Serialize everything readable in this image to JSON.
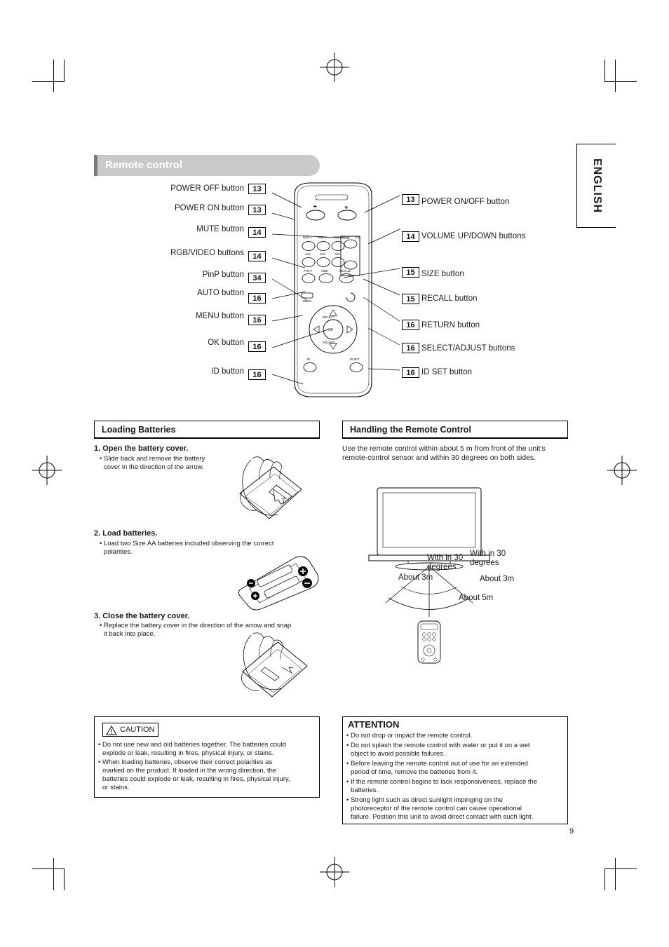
{
  "language_tab": "ENGLISH",
  "section_title": "Remote control",
  "page_number": "9",
  "remote_callouts_left": [
    {
      "label": "POWER OFF button",
      "num": "13"
    },
    {
      "label": "POWER ON button",
      "num": "13"
    },
    {
      "label": "MUTE button",
      "num": "14"
    },
    {
      "label": "RGB/VIDEO buttons",
      "num": "14"
    },
    {
      "label": "PinP button",
      "num": "34"
    },
    {
      "label": "AUTO button",
      "num": "16"
    },
    {
      "label": "MENU button",
      "num": "16"
    },
    {
      "label": "OK button",
      "num": "16"
    },
    {
      "label": "ID button",
      "num": "16"
    }
  ],
  "remote_callouts_right": [
    {
      "num": "13",
      "label": "POWER ON/OFF button"
    },
    {
      "num": "14",
      "label": "VOLUME UP/DOWN buttons"
    },
    {
      "num": "15",
      "label": "SIZE button"
    },
    {
      "num": "15",
      "label": "RECALL button"
    },
    {
      "num": "16",
      "label": "RETURN button"
    },
    {
      "num": "16",
      "label": "SELECT/ADJUST buttons"
    },
    {
      "num": "16",
      "label": "ID SET button"
    }
  ],
  "remote_keys": {
    "row_top": [
      "RGB 1",
      "RGB 2",
      "VIDEO",
      "MUTE",
      "VOL +"
    ],
    "row_2": [
      "AV1",
      "AV2",
      "AV3",
      "VOL -"
    ],
    "row_3": [
      "P IN P",
      "SIZE",
      "RECALL"
    ],
    "menu": "MENU",
    "ok": "OK",
    "id": "ID",
    "id_set": "ID SET",
    "auto": "AUTO"
  },
  "loading_batteries": {
    "heading": "Loading Batteries",
    "steps": [
      {
        "title": "1. Open the battery cover.",
        "bullets": [
          "• Slide back and remove the battery",
          "cover in the direction of the arrow."
        ]
      },
      {
        "title": "2. Load batteries.",
        "bullets": [
          "• Load two Size AA batteries included observing the correct",
          "polarities."
        ]
      },
      {
        "title": "3. Close the battery cover.",
        "bullets": [
          "• Replace the battery cover in the direction of the arrow and snap",
          "it back into place."
        ]
      }
    ]
  },
  "handling": {
    "heading": "Handling the Remote Control",
    "intro_lines": [
      "Use the remote control within about 5 m from front of the unit's",
      "remote-control sensor and within 30 degrees on both sides."
    ],
    "diagram_labels": {
      "left_angle_1": "With in 30",
      "left_angle_2": "degrees",
      "right_angle_1": "With in 30",
      "right_angle_2": "degrees",
      "left_distance": "About 3m",
      "right_distance": "About 3m",
      "center_distance": "About 5m"
    }
  },
  "caution": {
    "tag": "CAUTION",
    "lines": [
      "• Do not use new and old batteries together.  The batteries could",
      "explode or leak, resulting in fires, physical injury, or stains.",
      "• When loading batteries, observe their correct polarities as",
      "marked on the product. If loaded in the wrong direction, the",
      "batteries could explode or leak, resulting in fires, physical injury,",
      "or stains."
    ]
  },
  "attention": {
    "title": "ATTENTION",
    "lines": [
      "• Do not drop or impact the remote control.",
      "• Do not splash the remote control with water or put it on a wet",
      "object to avoid possible failures.",
      "• Before leaving the remote control out of use for an extended",
      "period of time, remove the batteries from it.",
      "• If the remote control begins to lack responsiveness, replace the",
      "batteries.",
      "• Strong light such as direct sunlight impinging on the",
      "photoreceptor of the remote control can cause operational",
      "failure. Position this unit to avoid direct contact with such light."
    ]
  }
}
